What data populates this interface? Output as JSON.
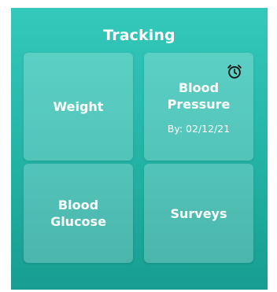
{
  "header": {
    "title": "Tracking"
  },
  "tiles": [
    {
      "label": "Weight",
      "sub": ""
    },
    {
      "label": "Blood\nPressure",
      "sub": "By: 02/12/21",
      "icon": "alarm-clock-icon"
    },
    {
      "label": "Blood\nGlucose",
      "sub": ""
    },
    {
      "label": "Surveys",
      "sub": ""
    }
  ],
  "colors": {
    "panel_top": "#34c9bb",
    "panel_bottom": "#179d91",
    "text": "#ffffff"
  }
}
